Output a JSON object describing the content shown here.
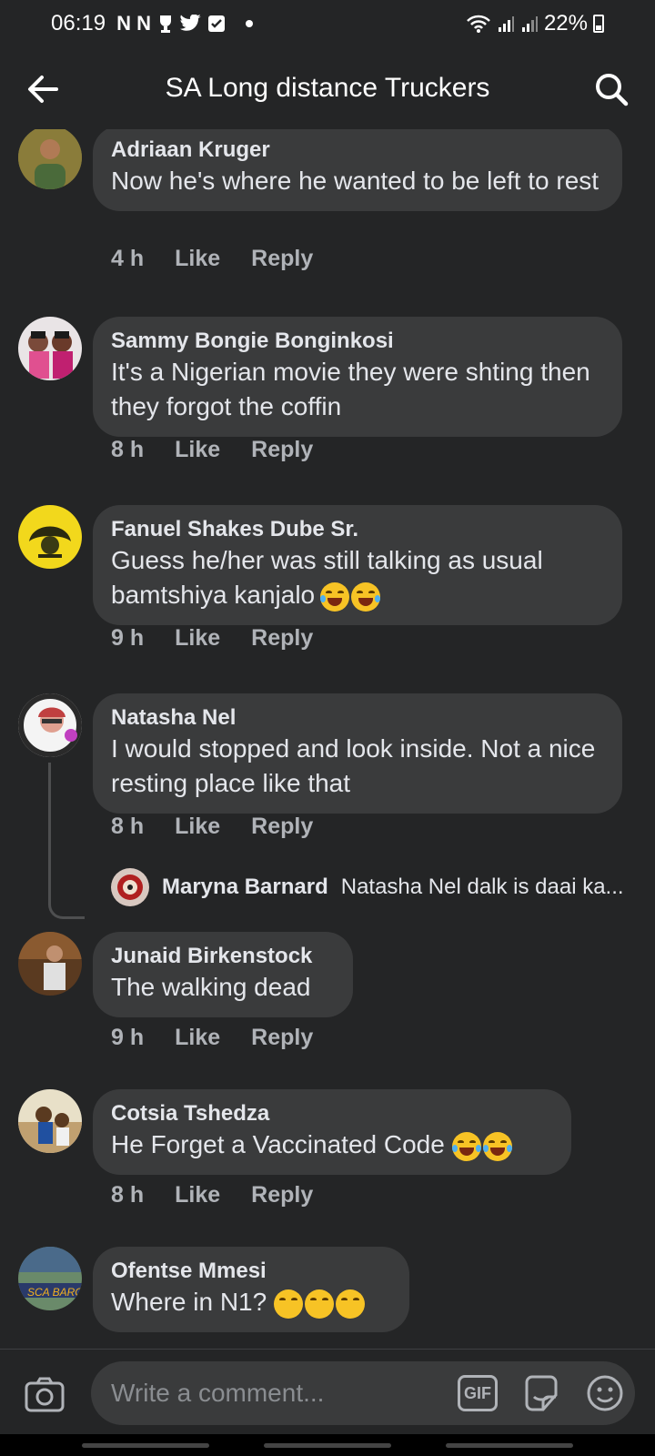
{
  "status": {
    "time": "06:19",
    "notif_icons": "N N",
    "battery": "22%"
  },
  "header": {
    "title": "SA Long distance Truckers"
  },
  "comments": [
    {
      "author": "Adriaan Kruger",
      "text": "Now he's where he wanted  to be left to rest",
      "time": "4 h",
      "like": "Like",
      "reply": "Reply",
      "avatar_color": "#6b6a3a"
    },
    {
      "author": "Sammy Bongie Bonginkosi",
      "text": "It's a Nigerian movie they were shting then they forgot the coffin",
      "time": "8 h",
      "like": "Like",
      "reply": "Reply",
      "avatar_color": "#3d2b30"
    },
    {
      "author": "Fanuel Shakes Dube Sr.",
      "text": "Guess he/her was still talking as usual bamtshiya kanjalo",
      "time": "9 h",
      "like": "Like",
      "reply": "Reply",
      "avatar_color": "#e8d21a"
    },
    {
      "author": "Natasha Nel",
      "text": "I would stopped and look inside. Not a nice resting place like that",
      "time": "8 h",
      "like": "Like",
      "reply": "Reply",
      "avatar_color": "#c98a8a"
    },
    {
      "author": "Junaid Birkenstock",
      "text": "The walking dead",
      "time": "9 h",
      "like": "Like",
      "reply": "Reply",
      "avatar_color": "#7a5530"
    },
    {
      "author": "Cotsia Tshedza",
      "text": "He Forget a Vaccinated Code",
      "time": "8 h",
      "like": "Like",
      "reply": "Reply",
      "avatar_color": "#a89060"
    },
    {
      "author": "Ofentse Mmesi",
      "text": "Where in N1?",
      "time": "",
      "like": "",
      "reply": "",
      "avatar_color": "#4a6a4a"
    }
  ],
  "reply_preview": {
    "author": "Maryna Barnard",
    "text": "Natasha Nel dalk is daai ka..."
  },
  "composer": {
    "placeholder": "Write a comment...",
    "gif_label": "GIF"
  },
  "colors": {
    "background": "#242526",
    "bubble": "#3a3b3c",
    "text": "#e4e6eb",
    "muted": "#b0b3b8"
  }
}
